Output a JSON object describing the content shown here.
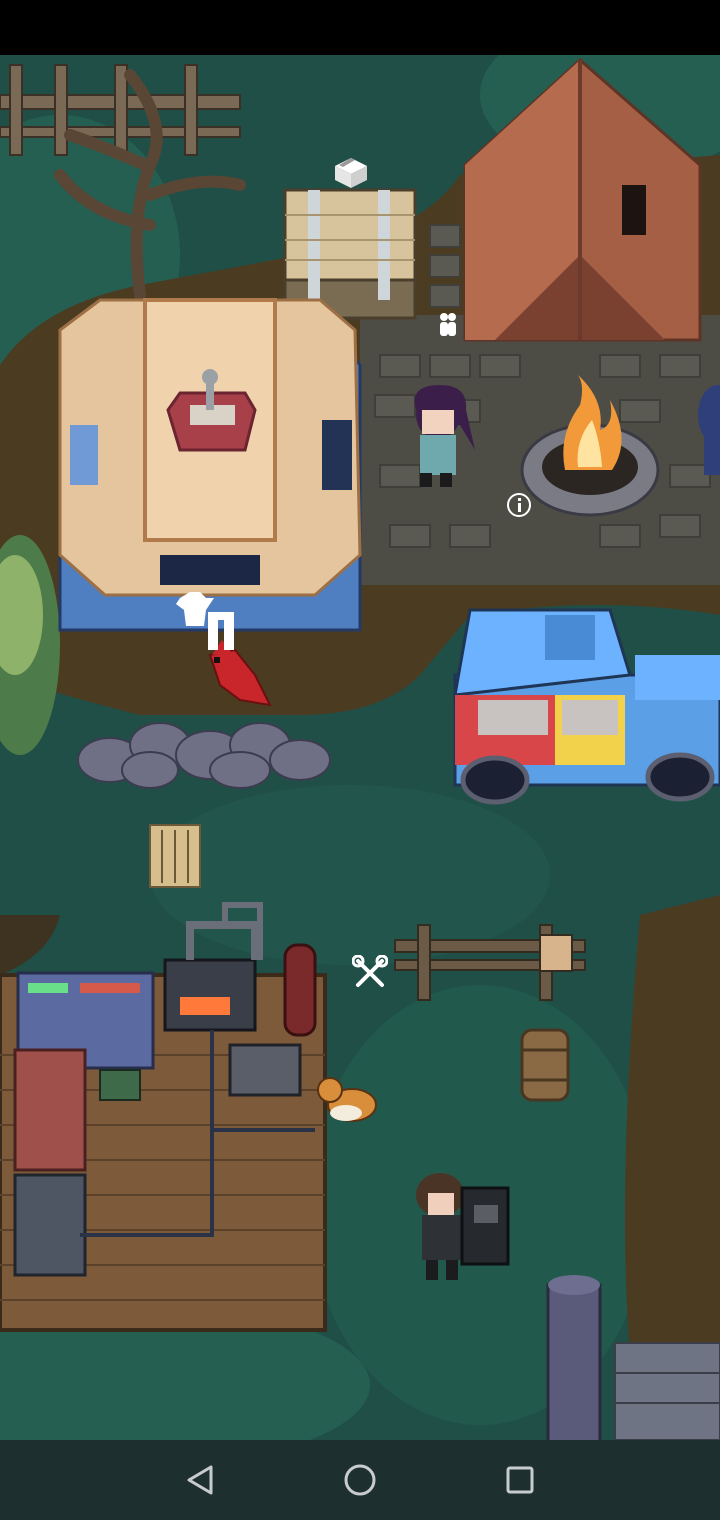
{
  "screen": {
    "background": "#1f4f47",
    "grass_color": "#2b6356",
    "dirt_color": "#4a3a22",
    "stone_color": "#4c4c46"
  },
  "icons": {
    "supply_crate": "box-icon",
    "tent_people": "people-icon",
    "campfire_info": "info-icon",
    "wardrobe": "clothes-icon",
    "workshop": "tools-icon"
  },
  "nav": {
    "back": "back-triangle-icon",
    "home": "home-circle-icon",
    "recents": "recents-square-icon"
  }
}
